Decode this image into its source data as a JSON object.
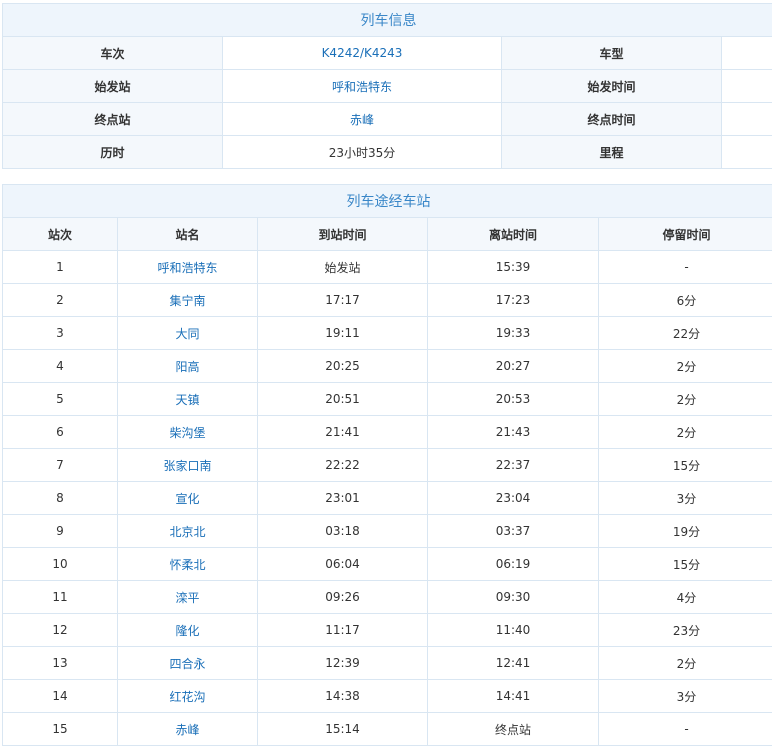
{
  "train_info": {
    "title": "列车信息",
    "rows": [
      {
        "label1": "车次",
        "value1": "K4242/K4243",
        "label2": "车型",
        "value2": ""
      },
      {
        "label1": "始发站",
        "value1": "呼和浩特东",
        "label2": "始发时间",
        "value2": ""
      },
      {
        "label1": "终点站",
        "value1": "赤峰",
        "label2": "终点时间",
        "value2": ""
      },
      {
        "label1": "历时",
        "value1": "23小时35分",
        "label2": "里程",
        "value2": ""
      }
    ]
  },
  "stops": {
    "title": "列车途经车站",
    "headers": [
      "站次",
      "站名",
      "到站时间",
      "离站时间",
      "停留时间"
    ],
    "rows": [
      {
        "no": "1",
        "name": "呼和浩特东",
        "arrive": "始发站",
        "depart": "15:39",
        "stay": "-"
      },
      {
        "no": "2",
        "name": "集宁南",
        "arrive": "17:17",
        "depart": "17:23",
        "stay": "6分"
      },
      {
        "no": "3",
        "name": "大同",
        "arrive": "19:11",
        "depart": "19:33",
        "stay": "22分"
      },
      {
        "no": "4",
        "name": "阳高",
        "arrive": "20:25",
        "depart": "20:27",
        "stay": "2分"
      },
      {
        "no": "5",
        "name": "天镇",
        "arrive": "20:51",
        "depart": "20:53",
        "stay": "2分"
      },
      {
        "no": "6",
        "name": "柴沟堡",
        "arrive": "21:41",
        "depart": "21:43",
        "stay": "2分"
      },
      {
        "no": "7",
        "name": "张家口南",
        "arrive": "22:22",
        "depart": "22:37",
        "stay": "15分"
      },
      {
        "no": "8",
        "name": "宣化",
        "arrive": "23:01",
        "depart": "23:04",
        "stay": "3分"
      },
      {
        "no": "9",
        "name": "北京北",
        "arrive": "03:18",
        "depart": "03:37",
        "stay": "19分"
      },
      {
        "no": "10",
        "name": "怀柔北",
        "arrive": "06:04",
        "depart": "06:19",
        "stay": "15分"
      },
      {
        "no": "11",
        "name": "滦平",
        "arrive": "09:26",
        "depart": "09:30",
        "stay": "4分"
      },
      {
        "no": "12",
        "name": "隆化",
        "arrive": "11:17",
        "depart": "11:40",
        "stay": "23分"
      },
      {
        "no": "13",
        "name": "四合永",
        "arrive": "12:39",
        "depart": "12:41",
        "stay": "2分"
      },
      {
        "no": "14",
        "name": "红花沟",
        "arrive": "14:38",
        "depart": "14:41",
        "stay": "3分"
      },
      {
        "no": "15",
        "name": "赤峰",
        "arrive": "15:14",
        "depart": "终点站",
        "stay": "-"
      }
    ]
  },
  "colors": {
    "title_text": "#3a87c8",
    "link_text": "#1a6fb8",
    "border": "#d9e6f2",
    "header_bg": "#f4f8fc",
    "title_bg": "#eef5fc"
  }
}
